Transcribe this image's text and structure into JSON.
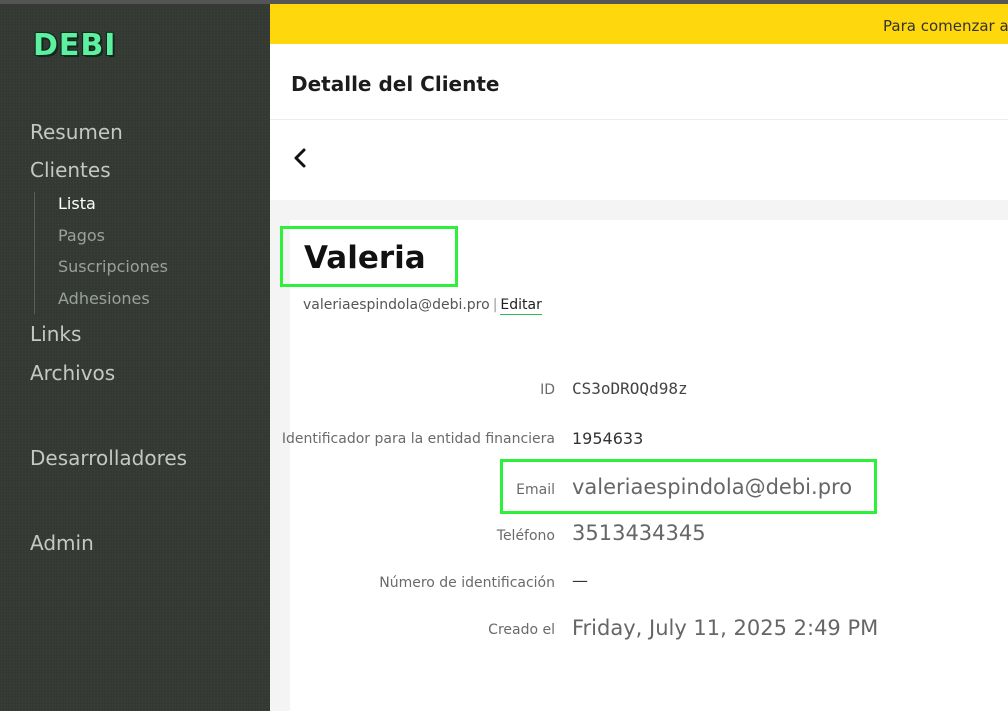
{
  "sidebar": {
    "logo": "DEBI",
    "nav": [
      {
        "label": "Resumen"
      },
      {
        "label": "Clientes"
      },
      {
        "label": "Links"
      },
      {
        "label": "Archivos"
      },
      {
        "label": "Desarrolladores"
      },
      {
        "label": "Admin"
      }
    ],
    "clientes_sub": [
      {
        "label": "Lista",
        "active": true
      },
      {
        "label": "Pagos"
      },
      {
        "label": "Suscripciones"
      },
      {
        "label": "Adhesiones"
      }
    ]
  },
  "banner": {
    "text": "Para comenzar a c"
  },
  "header": {
    "title": "Detalle del Cliente"
  },
  "back": {
    "icon": "chevron-left-icon"
  },
  "client": {
    "name": "Valeria",
    "email": "valeriaespindola@debi.pro",
    "separator": "|",
    "edit_label": "Editar",
    "fields": {
      "id": {
        "label": "ID",
        "value": "CS3oDROQd98z"
      },
      "financial_id": {
        "label": "Identificador para la entidad financiera",
        "value": "1954633"
      },
      "email": {
        "label": "Email",
        "value": "valeriaespindola@debi.pro"
      },
      "phone": {
        "label": "Teléfono",
        "value": "3513434345"
      },
      "id_number": {
        "label": "Número de identificación",
        "value": "—"
      },
      "created": {
        "label": "Creado el",
        "value": "Friday, July 11, 2025 2:49 PM"
      }
    }
  },
  "colors": {
    "accent": "#fed80c",
    "highlight": "#2df03a",
    "logo": "#5ef0a0",
    "sidebar": "#343833"
  }
}
